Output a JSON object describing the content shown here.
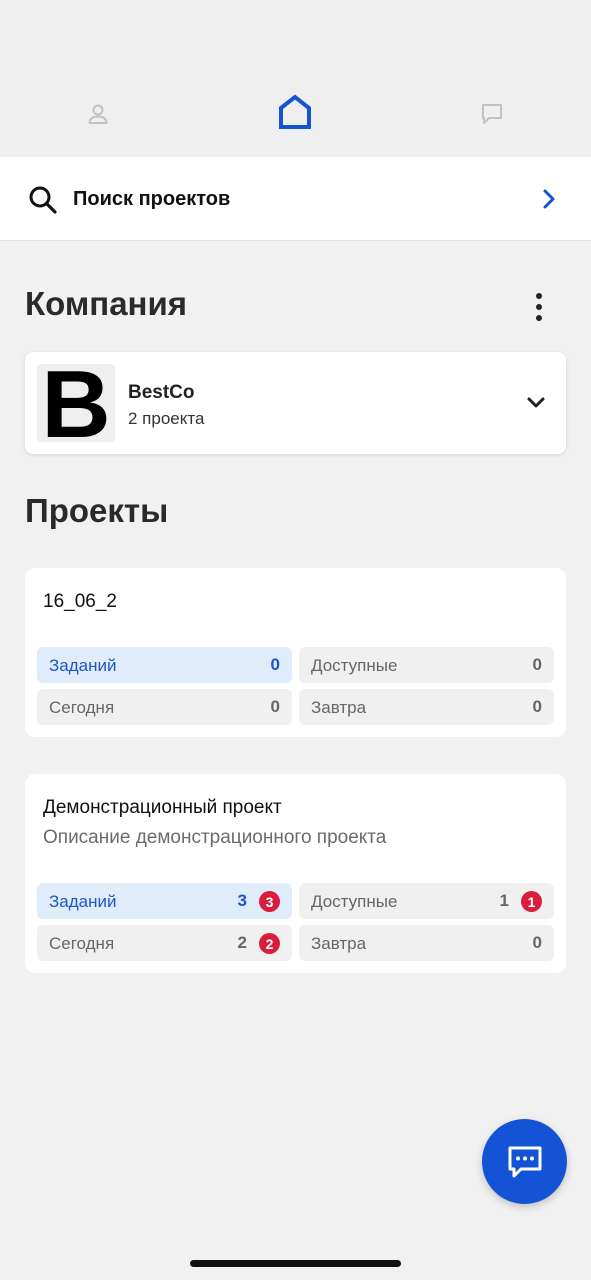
{
  "colors": {
    "accent": "#1453d6",
    "badge": "#d81e3c",
    "background": "#f1f1f1",
    "card": "#ffffff",
    "active_stat_bg": "#e1ecfb"
  },
  "nav": {
    "tabs": [
      {
        "icon": "person-icon",
        "active": false
      },
      {
        "icon": "home-icon",
        "active": true
      },
      {
        "icon": "chat-icon",
        "active": false
      }
    ]
  },
  "search": {
    "label": "Поиск проектов",
    "icon": "search-icon",
    "action_icon": "chevron-right-icon"
  },
  "company_section": {
    "title": "Компания",
    "menu_icon": "more-vertical-icon",
    "company": {
      "logo_letter": "B",
      "name": "BestCo",
      "subtitle": "2 проекта",
      "expand_icon": "chevron-down-icon"
    }
  },
  "projects_section": {
    "title": "Проекты",
    "projects": [
      {
        "name": "16_06_2",
        "description": "",
        "stats": {
          "tasks": {
            "label": "Заданий",
            "value": "0",
            "badge": ""
          },
          "available": {
            "label": "Доступные",
            "value": "0",
            "badge": ""
          },
          "today": {
            "label": "Сегодня",
            "value": "0",
            "badge": ""
          },
          "tomorrow": {
            "label": "Завтра",
            "value": "0",
            "badge": ""
          }
        }
      },
      {
        "name": "Демонстрационный проект",
        "description": "Описание демонстрационного проекта",
        "stats": {
          "tasks": {
            "label": "Заданий",
            "value": "3",
            "badge": "3"
          },
          "available": {
            "label": "Доступные",
            "value": "1",
            "badge": "1"
          },
          "today": {
            "label": "Сегодня",
            "value": "2",
            "badge": "2"
          },
          "tomorrow": {
            "label": "Завтра",
            "value": "0",
            "badge": ""
          }
        }
      }
    ]
  },
  "fab": {
    "icon": "chat-bubble-icon"
  }
}
